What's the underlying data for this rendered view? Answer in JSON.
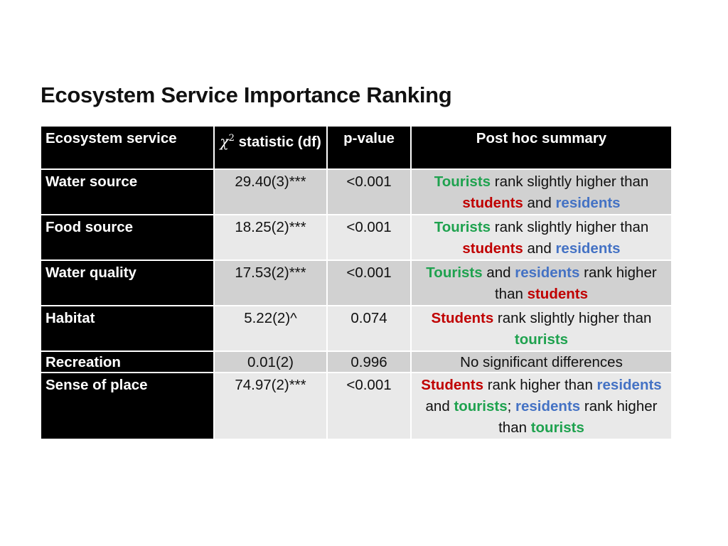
{
  "title": "Ecosystem Service Importance Ranking",
  "colors": {
    "tourists": "#1fa24f",
    "students": "#c00000",
    "residents": "#4472c4",
    "header_bg": "#000000",
    "row_dark": "#d1d1d1",
    "row_light": "#e9e9e9"
  },
  "table": {
    "headers": {
      "service": "Ecosystem service",
      "chi_symbol": "χ",
      "chi_sup": "2",
      "chi_text": " statistic (df)",
      "p_value": "p-value",
      "summary": "Post hoc summary"
    },
    "rows": [
      {
        "service": "Water source",
        "stat": "29.40(3)***",
        "p": "<0.001",
        "s": [
          "Tourists",
          " rank slightly higher than ",
          "students",
          " and ",
          "residents"
        ]
      },
      {
        "service": "Food source",
        "stat": "18.25(2)***",
        "p": "<0.001",
        "s": [
          "Tourists",
          " rank slightly higher than ",
          "students",
          " and ",
          "residents"
        ]
      },
      {
        "service": "Water quality",
        "stat": "17.53(2)***",
        "p": "<0.001",
        "s": [
          "Tourists",
          " and ",
          "residents",
          " rank higher than ",
          "students"
        ]
      },
      {
        "service": "Habitat",
        "stat": "5.22(2)^",
        "p": "0.074",
        "s": [
          "Students",
          " rank slightly higher than ",
          "tourists"
        ]
      },
      {
        "service": "Recreation",
        "stat": "0.01(2)",
        "p": "0.996",
        "s": [
          "No significant differences"
        ]
      },
      {
        "service": "Sense of place",
        "stat": "74.97(2)***",
        "p": "<0.001",
        "s": [
          "Students",
          " rank higher than ",
          "residents",
          " and ",
          "tourists",
          "; ",
          "residents",
          " rank higher than ",
          "tourists"
        ]
      }
    ]
  }
}
